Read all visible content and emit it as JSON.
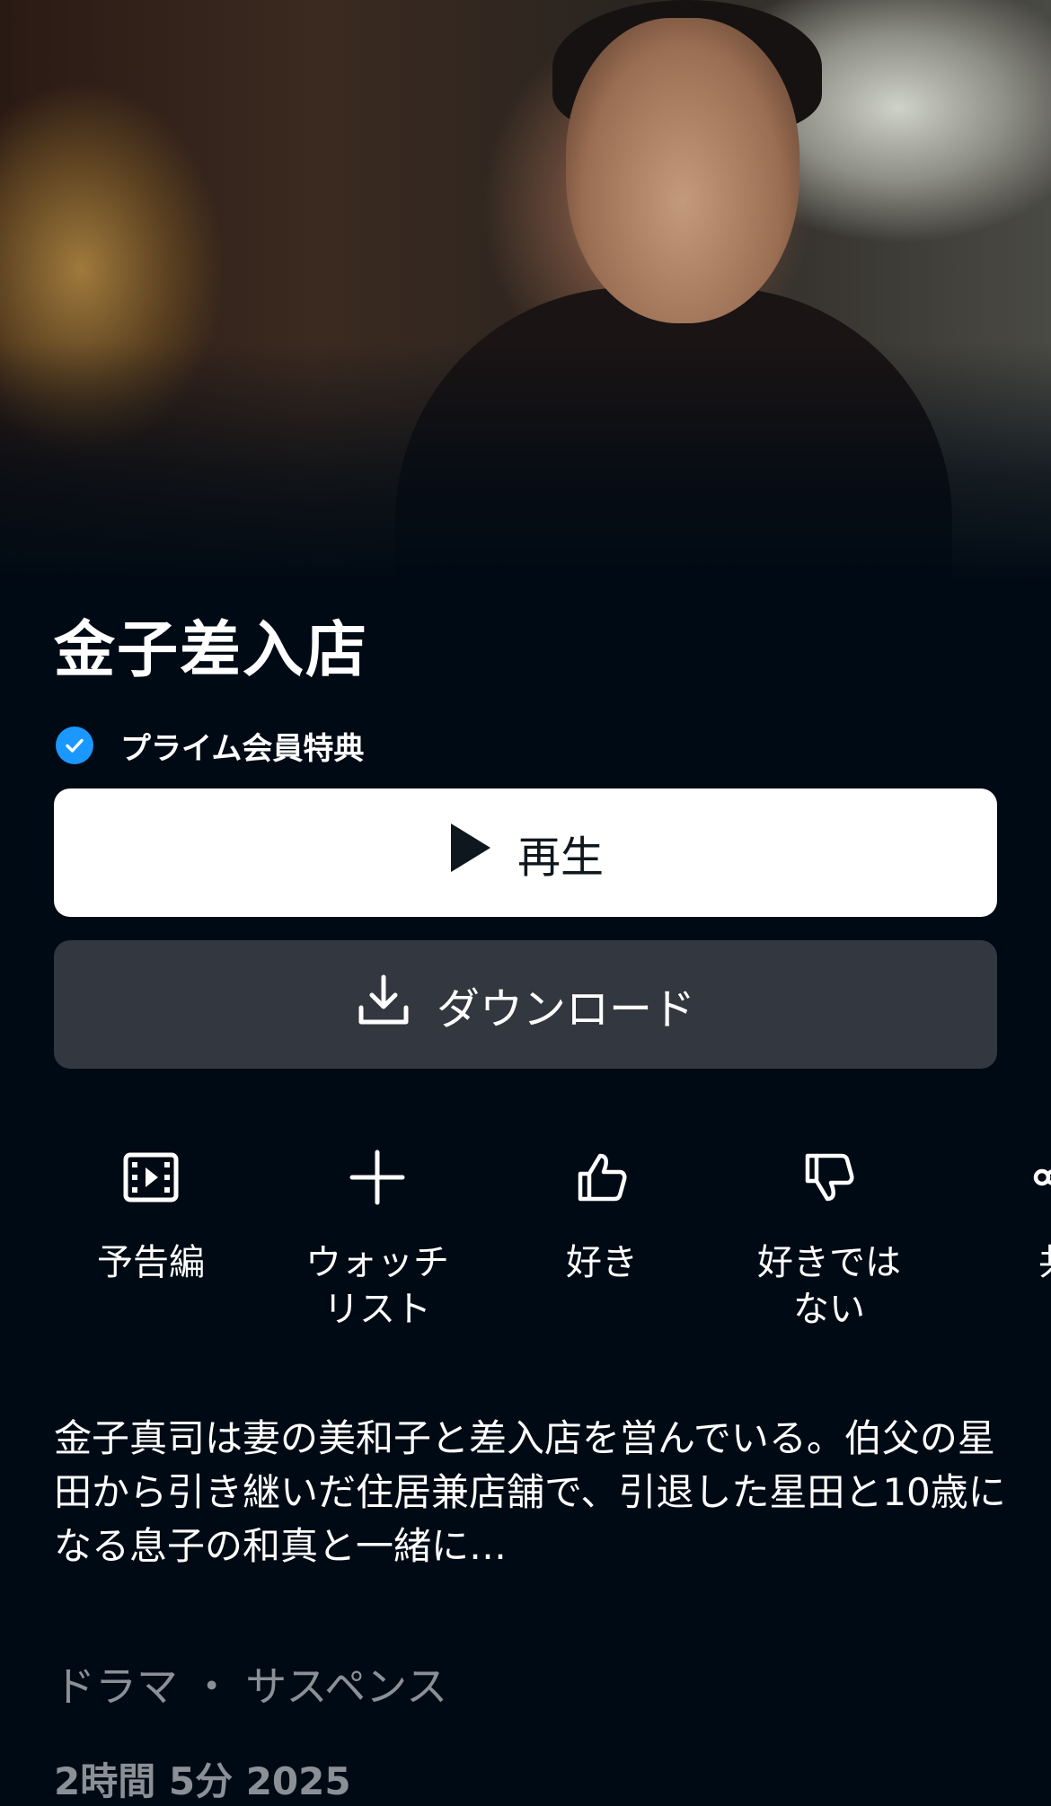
{
  "hero": {
    "image_alt": ""
  },
  "title": "金子差入店",
  "prime_badge": "プライム会員特典",
  "buttons": {
    "play": "再生",
    "download": "ダウンロード"
  },
  "actions": [
    {
      "label": "予告編",
      "icon": "trailer-icon"
    },
    {
      "label": "ウォッチ\nリスト",
      "icon": "plus-icon"
    },
    {
      "label": "好き",
      "icon": "thumbs-up-icon"
    },
    {
      "label": "好きでは\nない",
      "icon": "thumbs-down-icon"
    },
    {
      "label": "共",
      "icon": "share-icon"
    }
  ],
  "description": "金子真司は妻の美和子と差入店を営んでいる。伯父の星田から引き継いだ住居兼店舗で、引退した星田と10歳になる息子の和真と一緒に…",
  "genres": "ドラマ ・ サスペンス",
  "meta": "2時間 5分  2025",
  "colors": {
    "background": "#000a14",
    "accent_blue": "#1a98ff",
    "play_button": "#ffffff",
    "download_button": "#33373f",
    "muted_text": "#8b9096"
  }
}
